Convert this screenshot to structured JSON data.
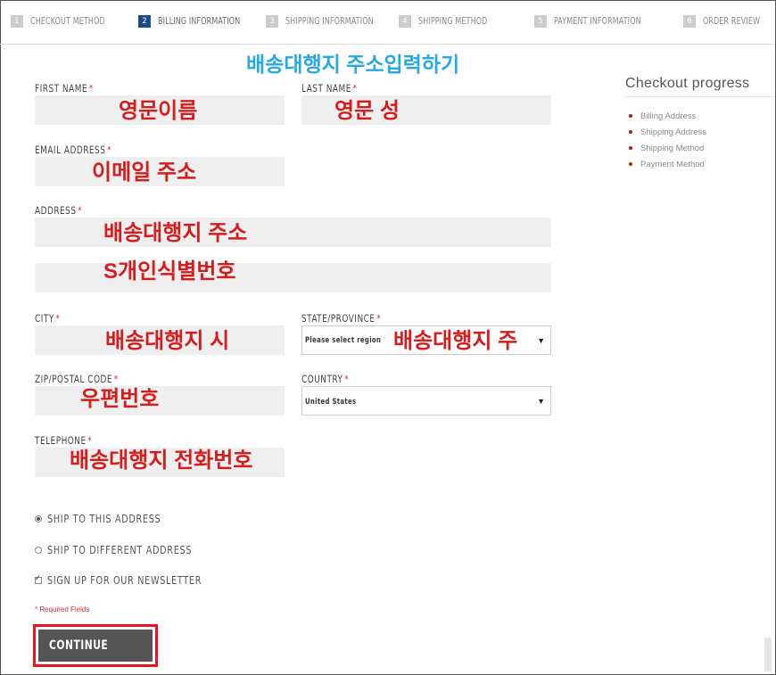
{
  "steps": [
    {
      "num": "1",
      "label": "CHECKOUT METHOD"
    },
    {
      "num": "2",
      "label": "BILLING INFORMATION"
    },
    {
      "num": "3",
      "label": "SHIPPING INFORMATION"
    },
    {
      "num": "4",
      "label": "SHIPPING METHOD"
    },
    {
      "num": "5",
      "label": "PAYMENT INFORMATION"
    },
    {
      "num": "6",
      "label": "ORDER REVIEW"
    }
  ],
  "active_step_color": "#1f4a8a",
  "page_note": "배송대행지 주소입력하기",
  "form": {
    "first_name": {
      "label": "FIRST NAME",
      "note": "영문이름"
    },
    "last_name": {
      "label": "LAST NAME",
      "note": "영문 성"
    },
    "email": {
      "label": "EMAIL ADDRESS",
      "note": "이메일 주소"
    },
    "address": {
      "label": "ADDRESS",
      "note1": "배송대행지 주소",
      "note2": "S개인식별번호"
    },
    "city": {
      "label": "CITY",
      "note": "배송대행지 시"
    },
    "state": {
      "label": "STATE/PROVINCE",
      "value": "Please select region",
      "note": "배송대행지 주"
    },
    "zip": {
      "label": "ZIP/POSTAL CODE",
      "note": "우편번호"
    },
    "country": {
      "label": "COUNTRY",
      "value": "United States"
    },
    "telephone": {
      "label": "TELEPHONE",
      "note": "배송대행지 전화번호"
    },
    "required_marker": "*"
  },
  "options": {
    "ship_same": "SHIP TO THIS ADDRESS",
    "ship_different": "SHIP TO DIFFERENT ADDRESS",
    "newsletter": "SIGN UP FOR OUR NEWSLETTER"
  },
  "required_note": "* Required Fields",
  "continue_label": "CONTINUE",
  "progress": {
    "title": "Checkout progress",
    "items": [
      "Billing Address",
      "Shipping Address",
      "Shipping Method",
      "Payment Method"
    ]
  },
  "colors": {
    "note_red": "#d41d1d",
    "note_blue": "#29a9e0",
    "highlight_border": "#e8141f",
    "bullet": "#b71d1d"
  }
}
